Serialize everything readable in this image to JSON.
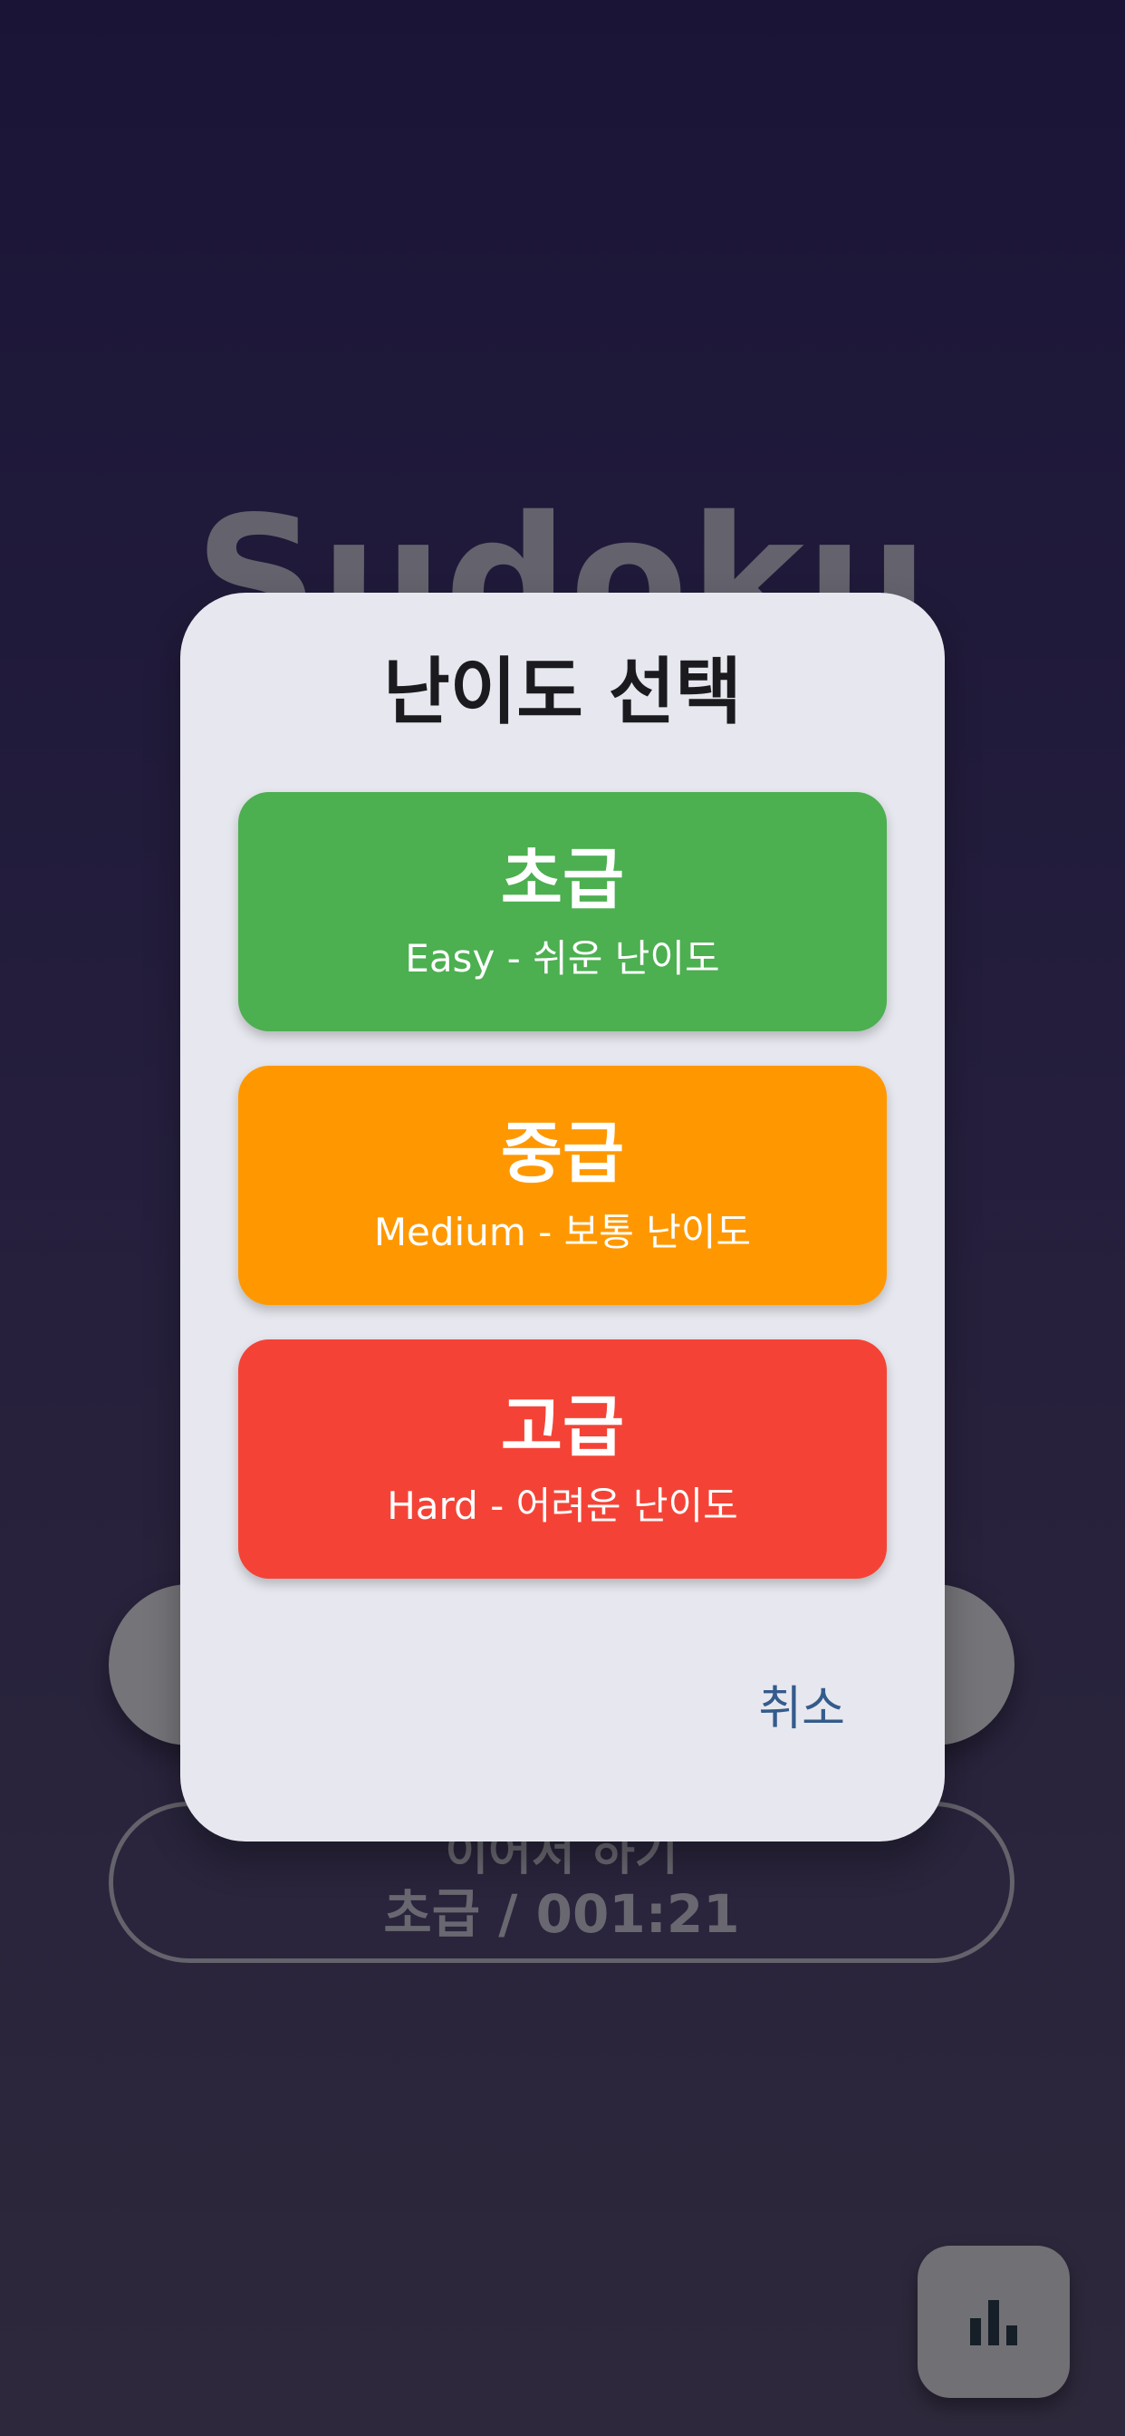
{
  "background": {
    "app_title": "Sudoku",
    "continue": {
      "label": "이어서 하기",
      "status": "초급 / 001:21"
    },
    "stats_button_icon": "bar-chart-icon"
  },
  "dialog": {
    "title": "난이도 선택",
    "options": [
      {
        "title": "초급",
        "description": "Easy - 쉬운 난이도",
        "color": "#4caf50"
      },
      {
        "title": "중급",
        "description": "Medium - 보통 난이도",
        "color": "#ff9800"
      },
      {
        "title": "고급",
        "description": "Hard - 어려운 난이도",
        "color": "#f44336"
      }
    ],
    "cancel_label": "취소"
  },
  "colors": {
    "accent_text": "#345b8c",
    "dialog_surface": "#e7e8ef",
    "background_top": "#35296f",
    "background_bottom": "#5b5176"
  }
}
